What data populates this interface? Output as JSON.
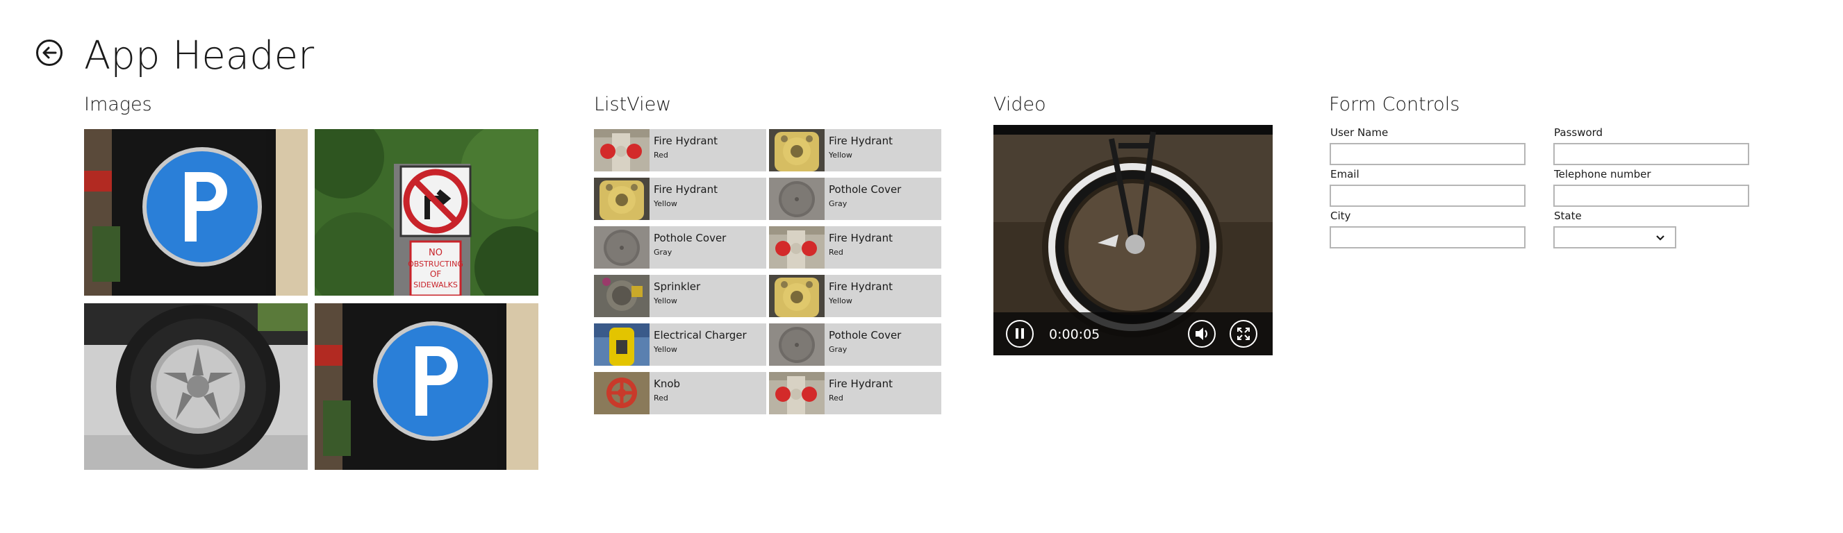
{
  "header": {
    "title": "App Header",
    "back_icon": "back-arrow-icon"
  },
  "sections": {
    "images": "Images",
    "listview": "ListView",
    "video": "Video",
    "form": "Form Controls"
  },
  "images": [
    {
      "subject": "parking-sign"
    },
    {
      "subject": "no-right-turn-sign"
    },
    {
      "subject": "tire"
    },
    {
      "subject": "parking-sign"
    }
  ],
  "listview": {
    "items": [
      {
        "title": "Fire Hydrant",
        "subtitle": "Red",
        "thumb": "hydrant-red"
      },
      {
        "title": "Fire Hydrant",
        "subtitle": "Yellow",
        "thumb": "hydrant-yellow"
      },
      {
        "title": "Fire Hydrant",
        "subtitle": "Yellow",
        "thumb": "hydrant-yellow"
      },
      {
        "title": "Pothole Cover",
        "subtitle": "Gray",
        "thumb": "pothole"
      },
      {
        "title": "Pothole Cover",
        "subtitle": "Gray",
        "thumb": "pothole"
      },
      {
        "title": "Fire Hydrant",
        "subtitle": "Red",
        "thumb": "hydrant-red"
      },
      {
        "title": "Sprinkler",
        "subtitle": "Yellow",
        "thumb": "sprinkler"
      },
      {
        "title": "Fire Hydrant",
        "subtitle": "Yellow",
        "thumb": "hydrant-yellow"
      },
      {
        "title": "Electrical Charger",
        "subtitle": "Yellow",
        "thumb": "charger"
      },
      {
        "title": "Pothole Cover",
        "subtitle": "Gray",
        "thumb": "pothole"
      },
      {
        "title": "Knob",
        "subtitle": "Red",
        "thumb": "knob"
      },
      {
        "title": "Fire Hydrant",
        "subtitle": "Red",
        "thumb": "hydrant-red"
      }
    ]
  },
  "video": {
    "time": "0:00:05",
    "icons": {
      "pause": "pause-icon",
      "volume": "volume-icon",
      "fullscreen": "fullscreen-icon"
    }
  },
  "form": {
    "username_label": "User Name",
    "password_label": "Password",
    "email_label": "Email",
    "telephone_label": "Telephone number",
    "city_label": "City",
    "state_label": "State",
    "username_value": "",
    "password_value": "",
    "email_value": "",
    "telephone_value": "",
    "city_value": "",
    "state_value": ""
  },
  "colors": {
    "parking_blue": "#2a7fd8",
    "list_item_bg": "#d4d4d4",
    "input_border": "#b5b5b5",
    "text": "#1a1a1a"
  }
}
